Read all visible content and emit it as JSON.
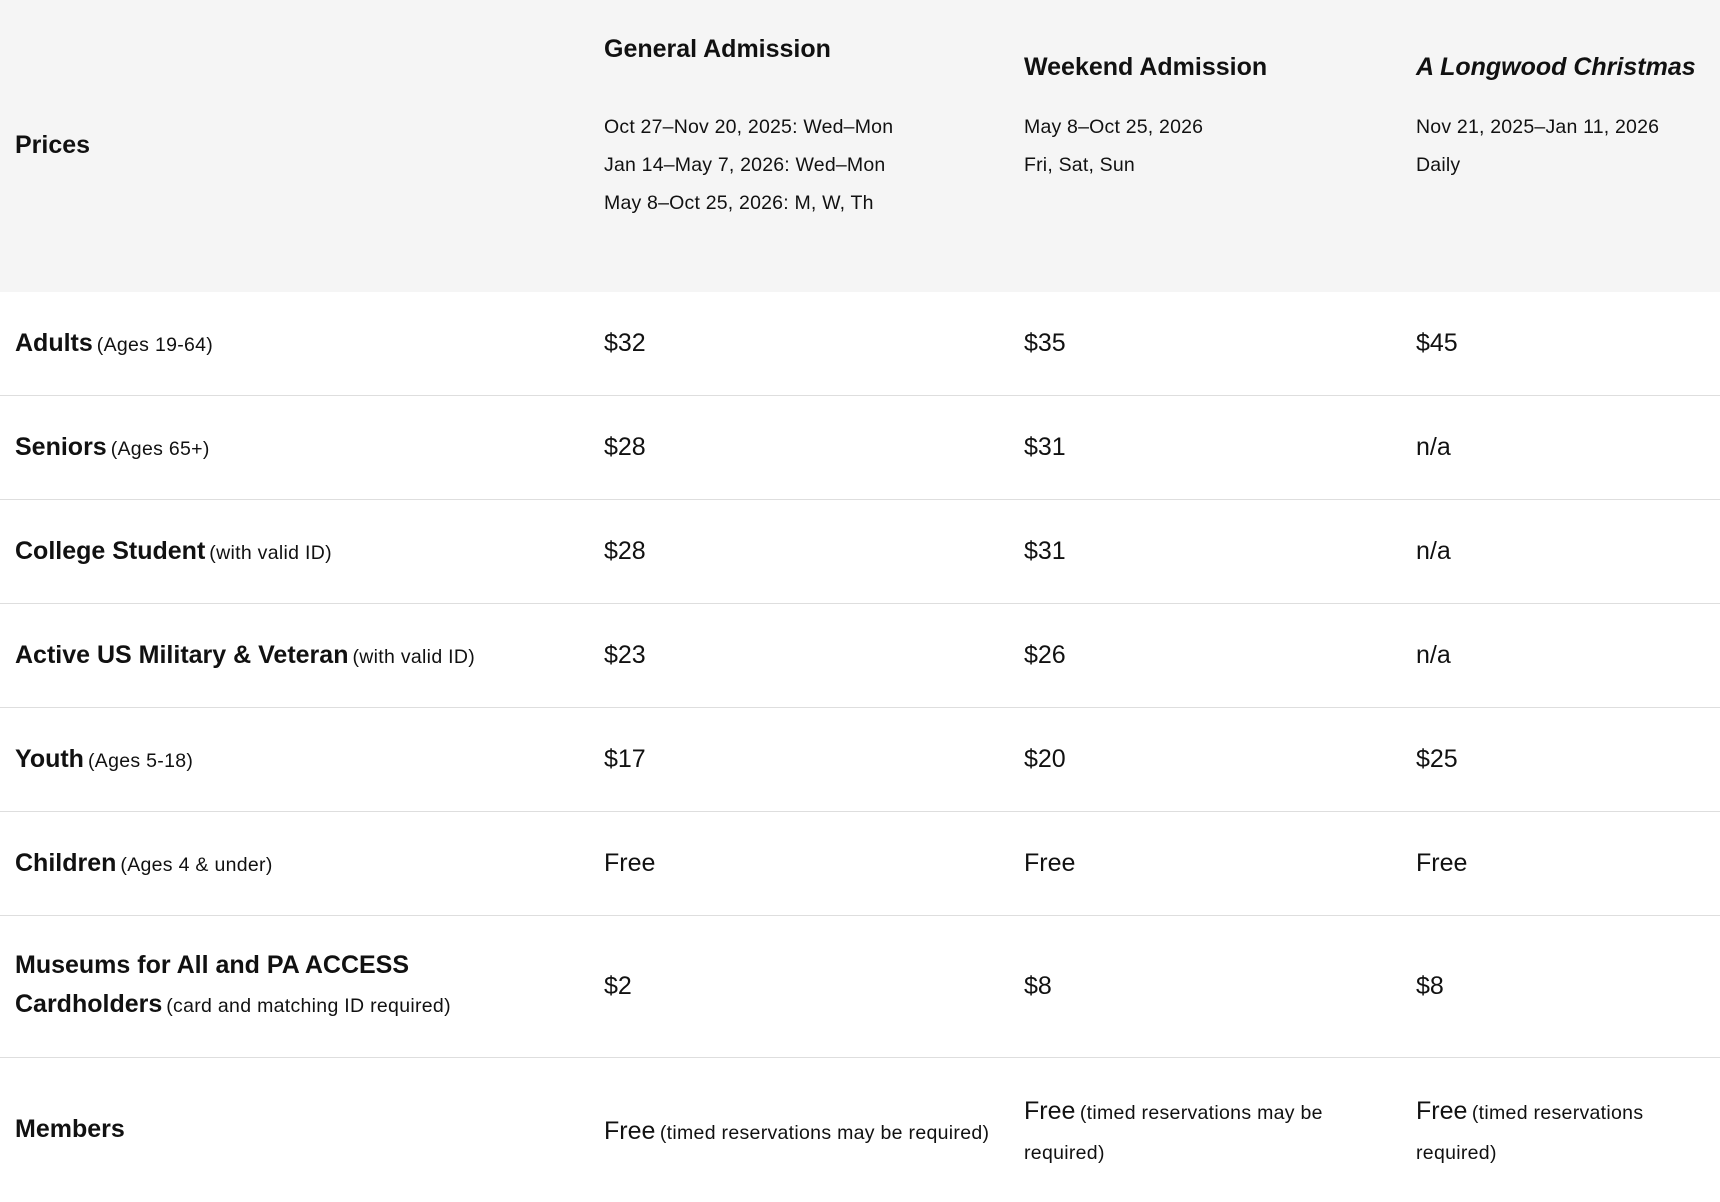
{
  "header": {
    "prices_label": "Prices",
    "general": {
      "title": "General Admission",
      "lines": [
        "Oct 27–Nov 20, 2025: Wed–Mon",
        "Jan 14–May 7, 2026: Wed–Mon",
        "May 8–Oct 25, 2026: M, W, Th"
      ]
    },
    "weekend": {
      "title": "Weekend Admission",
      "lines": [
        "May 8–Oct 25, 2026",
        "Fri, Sat, Sun"
      ]
    },
    "christmas": {
      "title": "A Longwood Christmas",
      "lines": [
        "Nov 21, 2025–Jan 11, 2026",
        "Daily"
      ]
    }
  },
  "rows": [
    {
      "name": "Adults",
      "note": "(Ages 19-64)",
      "general": "$32",
      "weekend": "$35",
      "christmas": "$45"
    },
    {
      "name": "Seniors",
      "note": "(Ages 65+)",
      "general": "$28",
      "weekend": "$31",
      "christmas": "n/a"
    },
    {
      "name": "College Student",
      "note": "(with valid ID)",
      "general": "$28",
      "weekend": "$31",
      "christmas": "n/a"
    },
    {
      "name": "Active US Military & Veteran",
      "note": "(with valid ID)",
      "general": "$23",
      "weekend": "$26",
      "christmas": "n/a"
    },
    {
      "name": "Youth",
      "note": "(Ages 5-18)",
      "general": "$17",
      "weekend": "$20",
      "christmas": "$25"
    },
    {
      "name": "Children",
      "note": "(Ages 4 & under)",
      "general": "Free",
      "weekend": "Free",
      "christmas": "Free"
    },
    {
      "name_line1": "Museums for All and PA ACCESS",
      "name_line2": "Cardholders",
      "note": "(card and matching ID required)",
      "general": "$2",
      "weekend": "$8",
      "christmas": "$8"
    }
  ],
  "members": {
    "name": "Members",
    "general": {
      "value": "Free",
      "note": "(timed reservations may be required)"
    },
    "weekend": {
      "value": "Free",
      "note": "(timed reservations may be required)"
    },
    "christmas": {
      "value": "Free",
      "note": "(timed reservations required)"
    }
  }
}
